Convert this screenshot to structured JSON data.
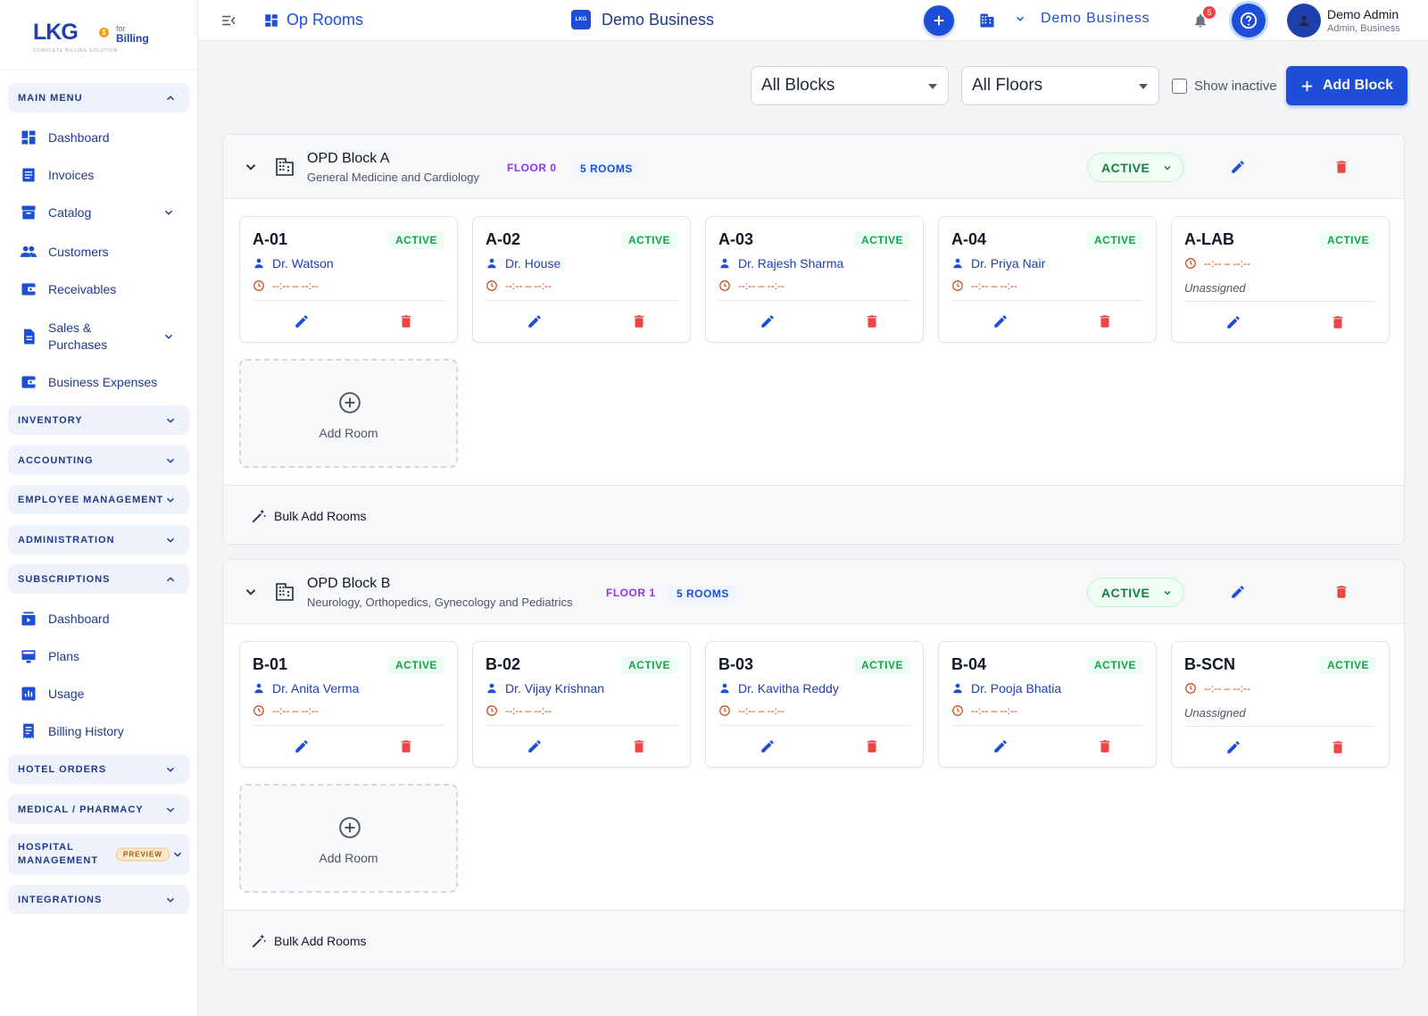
{
  "logo": {
    "brand": "LKG",
    "coin": "$",
    "for": "for",
    "product": "Billing",
    "tagline": "COMPLETE BILLING SOLUTION"
  },
  "sidebar": {
    "main_menu": "MAIN MENU",
    "main_items": [
      {
        "label": "Dashboard",
        "icon": "dashboard-icon"
      },
      {
        "label": "Invoices",
        "icon": "invoice-icon"
      },
      {
        "label": "Catalog",
        "icon": "catalog-icon"
      },
      {
        "label": "Customers",
        "icon": "customers-icon"
      },
      {
        "label": "Receivables",
        "icon": "receivables-icon"
      },
      {
        "label": "Sales & Purchases",
        "icon": "sales-icon"
      },
      {
        "label": "Business Expenses",
        "icon": "expenses-icon"
      }
    ],
    "sections": {
      "inventory": "INVENTORY",
      "accounting": "ACCOUNTING",
      "employee": "EMPLOYEE MANAGEMENT",
      "administration": "ADMINISTRATION",
      "subscriptions": "SUBSCRIPTIONS",
      "hotel": "HOTEL ORDERS",
      "medical": "MEDICAL / PHARMACY",
      "hospital": "HOSPITAL MANAGEMENT",
      "preview": "PREVIEW",
      "integrations": "INTEGRATIONS"
    },
    "sub_items": [
      {
        "label": "Dashboard",
        "icon": "subscription-dashboard-icon"
      },
      {
        "label": "Plans",
        "icon": "plans-icon"
      },
      {
        "label": "Usage",
        "icon": "usage-icon"
      },
      {
        "label": "Billing History",
        "icon": "billing-history-icon"
      }
    ]
  },
  "topbar": {
    "page_title": "Op Rooms",
    "business_title": "Demo Business",
    "business_logo_text": "LKG",
    "notification_count": "5",
    "business_select": "Demo Business",
    "user_name": "Demo Admin",
    "user_role": "Admin, Business"
  },
  "filters": {
    "blocks": "All Blocks",
    "floors": "All Floors",
    "show_inactive": "Show inactive",
    "add_block": "Add Block"
  },
  "blocks": [
    {
      "name": "OPD Block A",
      "description": "General Medicine and Cardiology",
      "floor": "FLOOR 0",
      "rooms_count": "5 ROOMS",
      "status": "ACTIVE",
      "add_room": "Add Room",
      "bulk_add": "Bulk Add Rooms",
      "rooms": [
        {
          "code": "A-01",
          "status": "ACTIVE",
          "doctor": "Dr. Watson",
          "time": "--:-- – --:--"
        },
        {
          "code": "A-02",
          "status": "ACTIVE",
          "doctor": "Dr. House",
          "time": "--:-- – --:--"
        },
        {
          "code": "A-03",
          "status": "ACTIVE",
          "doctor": "Dr. Rajesh Sharma",
          "time": "--:-- – --:--"
        },
        {
          "code": "A-04",
          "status": "ACTIVE",
          "doctor": "Dr. Priya Nair",
          "time": "--:-- – --:--"
        },
        {
          "code": "A-LAB",
          "status": "ACTIVE",
          "doctor": "",
          "time": "--:-- – --:--",
          "unassigned": "Unassigned"
        }
      ]
    },
    {
      "name": "OPD Block B",
      "description": "Neurology, Orthopedics, Gynecology and Pediatrics",
      "floor": "FLOOR 1",
      "rooms_count": "5 ROOMS",
      "status": "ACTIVE",
      "add_room": "Add Room",
      "bulk_add": "Bulk Add Rooms",
      "rooms": [
        {
          "code": "B-01",
          "status": "ACTIVE",
          "doctor": "Dr. Anita Verma",
          "time": "--:-- – --:--"
        },
        {
          "code": "B-02",
          "status": "ACTIVE",
          "doctor": "Dr. Vijay Krishnan",
          "time": "--:-- – --:--"
        },
        {
          "code": "B-03",
          "status": "ACTIVE",
          "doctor": "Dr. Kavitha Reddy",
          "time": "--:-- – --:--"
        },
        {
          "code": "B-04",
          "status": "ACTIVE",
          "doctor": "Dr. Pooja Bhatia",
          "time": "--:-- – --:--"
        },
        {
          "code": "B-SCN",
          "status": "ACTIVE",
          "doctor": "",
          "time": "--:-- – --:--",
          "unassigned": "Unassigned"
        }
      ]
    }
  ],
  "colors": {
    "primary": "#1d4ed8",
    "active_green": "#16a34a",
    "delete_red": "#ef4444",
    "floor_purple": "#9333ea"
  }
}
